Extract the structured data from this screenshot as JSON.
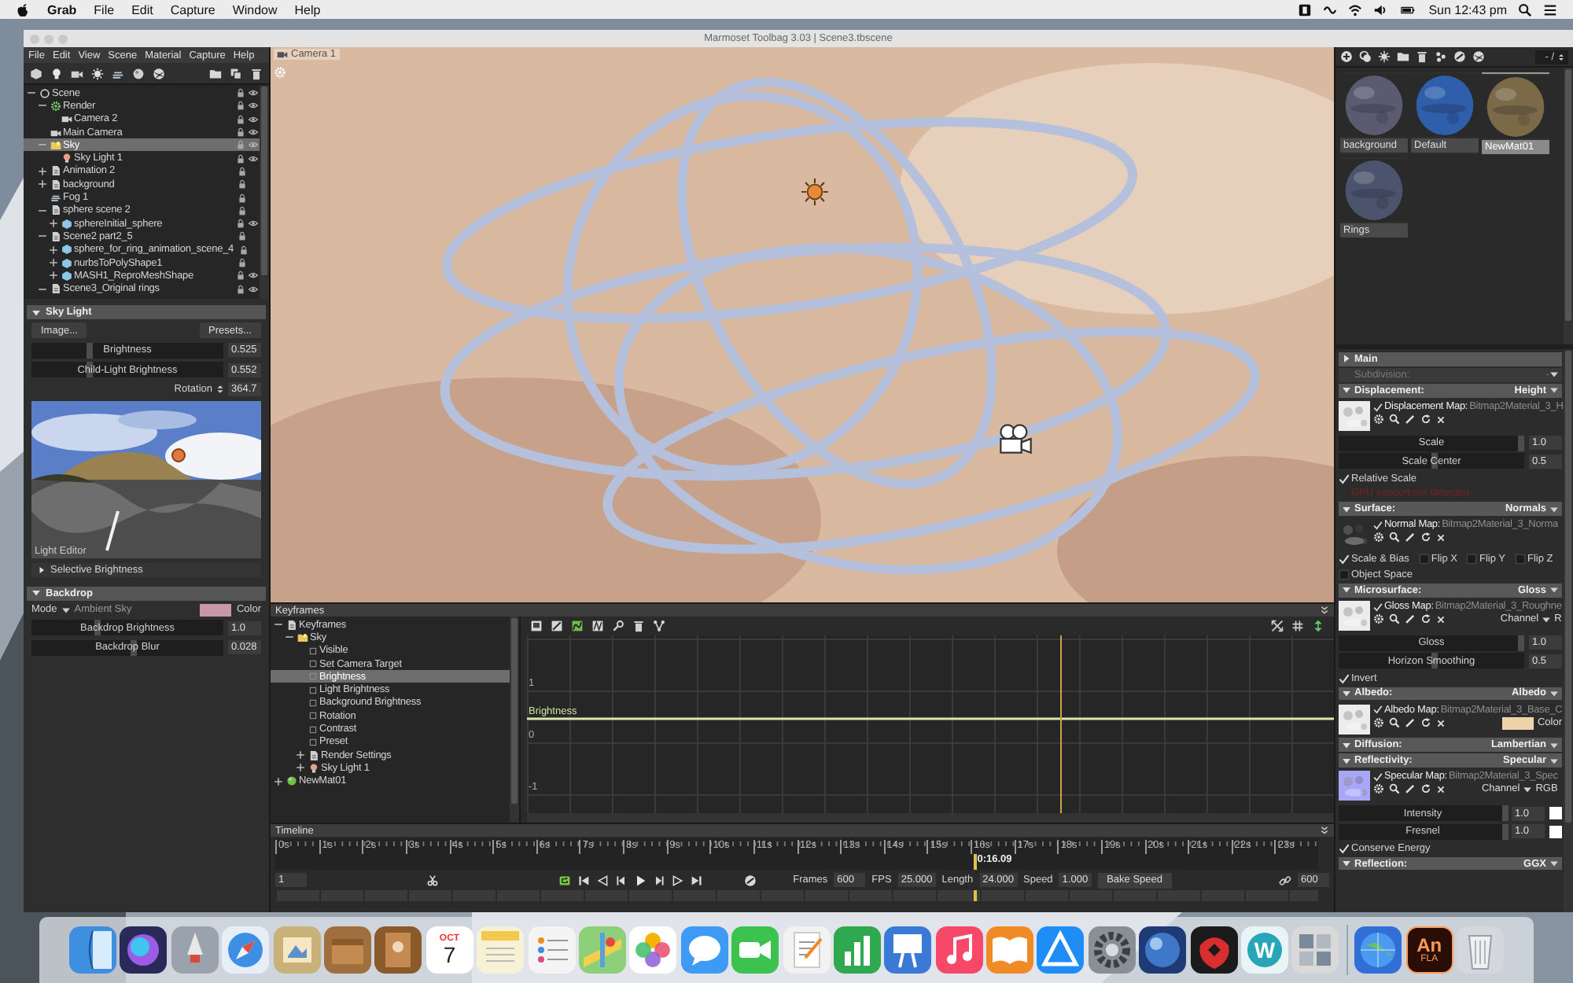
{
  "menubar": {
    "app": "Grab",
    "menus": [
      "File",
      "Edit",
      "Capture",
      "Window",
      "Help"
    ],
    "clock": "Sun 12:43 pm"
  },
  "window": {
    "title": "Marmoset Toolbag 3.03  |  Scene3.tbscene"
  },
  "app_menu": [
    "File",
    "Edit",
    "View",
    "Scene",
    "Material",
    "Capture",
    "Help"
  ],
  "scene_tree": [
    {
      "label": "Scene",
      "kind": "scene",
      "expanded": true,
      "selected": false,
      "visible": true,
      "children": [
        {
          "label": "Render",
          "kind": "render",
          "expanded": true,
          "selected": false,
          "visible": true,
          "children": [
            {
              "label": "Camera 2",
              "kind": "camera",
              "selected": false,
              "visible": true
            }
          ]
        },
        {
          "label": "Main Camera",
          "kind": "camera",
          "selected": false,
          "visible": true
        },
        {
          "label": "Sky",
          "kind": "sky",
          "expanded": true,
          "selected": true,
          "visible": true,
          "children": [
            {
              "label": "Sky Light 1",
              "kind": "light",
              "selected": false,
              "visible": true
            }
          ]
        },
        {
          "label": "Animation 2",
          "kind": "group",
          "expanded": false,
          "selected": false,
          "visible": false
        },
        {
          "label": "background",
          "kind": "group",
          "expanded": false,
          "selected": false,
          "visible": false
        },
        {
          "label": "Fog 1",
          "kind": "fog",
          "selected": false,
          "visible": false
        },
        {
          "label": "sphere scene 2",
          "kind": "group",
          "expanded": true,
          "selected": false,
          "visible": false,
          "children": [
            {
              "label": "sphereInitial_sphere",
              "kind": "mesh",
              "expanded": false,
              "selected": false,
              "visible": true
            }
          ]
        },
        {
          "label": "Scene2 part2_5",
          "kind": "group",
          "expanded": true,
          "selected": false,
          "visible": false,
          "children": [
            {
              "label": "sphere_for_ring_animation_scene_4",
              "kind": "mesh",
              "expanded": false,
              "selected": false,
              "visible": false
            },
            {
              "label": "nurbsToPolyShape1",
              "kind": "mesh",
              "expanded": false,
              "selected": false,
              "visible": false
            },
            {
              "label": "MASH1_ReproMeshShape",
              "kind": "mesh",
              "expanded": false,
              "selected": false,
              "visible": true
            }
          ]
        },
        {
          "label": "Scene3_Original rings",
          "kind": "group",
          "expanded": true,
          "selected": false,
          "visible": true
        }
      ]
    }
  ],
  "sky_light": {
    "title": "Sky Light",
    "expanded": true,
    "buttons": [
      "Image...",
      "Presets..."
    ],
    "sliders": [
      {
        "label": "Brightness",
        "value": "0.525",
        "level": 0.29
      },
      {
        "label": "Child-Light Brightness",
        "value": "0.552",
        "level": 0.29
      }
    ],
    "rotation": {
      "label": "Rotation",
      "value": "364.7"
    },
    "image_caption": "Light Editor",
    "selective": {
      "label": "Selective Brightness",
      "expanded": false
    }
  },
  "backdrop": {
    "title": "Backdrop",
    "expanded": true,
    "mode_label": "Mode",
    "mode_value": "Ambient Sky",
    "color": "#c897a8",
    "color_label": "Color",
    "sliders": [
      {
        "label": "Backdrop Brightness",
        "value": "1.0",
        "level": 0.33
      },
      {
        "label": "Backdrop Blur",
        "value": "0.028",
        "level": 0.52
      }
    ]
  },
  "viewport": {
    "tab": "Camera 1"
  },
  "keyframes": {
    "title": "Keyframes",
    "tree": [
      {
        "label": "Keyframes",
        "kind": "group",
        "expanded": true,
        "selected": false,
        "children": [
          {
            "label": "Sky",
            "kind": "sky",
            "expanded": true,
            "selected": false,
            "children": [
              {
                "label": "Visible",
                "kind": "channel",
                "selected": false
              },
              {
                "label": "Set Camera Target",
                "kind": "channel",
                "selected": false
              },
              {
                "label": "Brightness",
                "kind": "channel",
                "selected": true
              },
              {
                "label": "Light Brightness",
                "kind": "channel",
                "selected": false
              },
              {
                "label": "Background Brightness",
                "kind": "channel",
                "selected": false
              },
              {
                "label": "Rotation",
                "kind": "channel",
                "selected": false
              },
              {
                "label": "Contrast",
                "kind": "channel",
                "selected": false
              },
              {
                "label": "Preset",
                "kind": "channel",
                "selected": false
              },
              {
                "label": "Render Settings",
                "kind": "group",
                "expanded": false,
                "selected": false
              },
              {
                "label": "Sky Light 1",
                "kind": "light",
                "expanded": false,
                "selected": false
              }
            ]
          }
        ]
      },
      {
        "label": "NewMat01",
        "kind": "material",
        "expanded": false,
        "selected": false
      }
    ],
    "graph": {
      "yticks": [
        "1",
        "0",
        "-1"
      ],
      "curve_label": "Brightness",
      "level": 0.66
    }
  },
  "timeline": {
    "title": "Timeline",
    "ticks": [
      "0s",
      "1s",
      "2s",
      "3s",
      "4s",
      "5s",
      "6s",
      "7s",
      "8s",
      "9s",
      "10s",
      "11s",
      "12s",
      "13s",
      "14s",
      "15s",
      "16s",
      "17s",
      "18s",
      "19s",
      "20s",
      "21s",
      "22s",
      "23s"
    ],
    "playhead": "0:16.09",
    "level": 0.67,
    "start_frame": "1",
    "loop": true,
    "fields": [
      {
        "label": "Frames",
        "value": "600"
      },
      {
        "label": "FPS",
        "value": "25.000"
      },
      {
        "label": "Length",
        "value": "24.000"
      },
      {
        "label": "Speed",
        "value": "1.000"
      }
    ],
    "bake_button": "Bake Speed",
    "end_frame": "600"
  },
  "materials": {
    "counter": "- /",
    "items": [
      {
        "label": "background",
        "selected": false
      },
      {
        "label": "Default",
        "selected": false
      },
      {
        "label": "NewMat01",
        "selected": true
      },
      {
        "label": "Rings",
        "selected": false
      }
    ]
  },
  "properties": [
    {
      "kind": "section",
      "title": "Main",
      "expanded": false
    },
    {
      "kind": "dropdown",
      "label": "Subdivision:",
      "value": "-",
      "disabled": true
    },
    {
      "kind": "section",
      "title": "Displacement:",
      "value": "Height",
      "expanded": true
    },
    {
      "kind": "map",
      "label": "Displacement Map:",
      "file": "Bitmap2Material_3_H",
      "checked": true
    },
    {
      "kind": "slider",
      "label": "Scale",
      "value": "1.0",
      "level": 0.97
    },
    {
      "kind": "slider",
      "label": "Scale Center",
      "value": "0.5",
      "level": 0.5
    },
    {
      "kind": "check",
      "label": "Relative Scale",
      "checked": true
    },
    {
      "kind": "warning",
      "label": "GPU support not detected"
    },
    {
      "kind": "section",
      "title": "Surface:",
      "value": "Normals",
      "expanded": true
    },
    {
      "kind": "map",
      "label": "Normal Map:",
      "file": "Bitmap2Material_3_Norma",
      "checked": true
    },
    {
      "kind": "checks",
      "items": [
        {
          "label": "Scale & Bias",
          "checked": true
        },
        {
          "label": "Flip X",
          "checked": false
        },
        {
          "label": "Flip Y",
          "checked": false
        },
        {
          "label": "Flip Z",
          "checked": false
        }
      ]
    },
    {
      "kind": "check",
      "label": "Object Space",
      "checked": false
    },
    {
      "kind": "section",
      "title": "Microsurface:",
      "value": "Gloss",
      "expanded": true
    },
    {
      "kind": "map",
      "label": "Gloss Map:",
      "file": "Bitmap2Material_3_Roughne",
      "checked": true,
      "channel_label": "Channel",
      "channel": "R"
    },
    {
      "kind": "slider",
      "label": "Gloss",
      "value": "1.0",
      "level": 0.97
    },
    {
      "kind": "slider",
      "label": "Horizon Smoothing",
      "value": "0.5",
      "level": 0.5
    },
    {
      "kind": "check",
      "label": "Invert",
      "checked": true
    },
    {
      "kind": "section",
      "title": "Albedo:",
      "value": "Albedo",
      "expanded": true
    },
    {
      "kind": "map",
      "label": "Albedo Map:",
      "file": "Bitmap2Material_3_Base_C",
      "checked": true,
      "color": "#ecd3a9",
      "color_label": "Color"
    },
    {
      "kind": "section",
      "title": "Diffusion:",
      "value": "Lambertian",
      "expanded": true
    },
    {
      "kind": "section",
      "title": "Reflectivity:",
      "value": "Specular",
      "expanded": true
    },
    {
      "kind": "map",
      "label": "Specular Map:",
      "file": "Bitmap2Material_3_Spec",
      "checked": true,
      "channel_label": "Channel",
      "channel": "RGB"
    },
    {
      "kind": "slider",
      "label": "Intensity",
      "value": "1.0",
      "level": 0.97,
      "color": "#ffffff"
    },
    {
      "kind": "slider",
      "label": "Fresnel",
      "value": "1.0",
      "level": 0.97,
      "color": "#ffffff"
    },
    {
      "kind": "check",
      "label": "Conserve Energy",
      "checked": true
    },
    {
      "kind": "section",
      "title": "Reflection:",
      "value": "GGX",
      "expanded": true
    }
  ],
  "dock": {
    "calendar_month": "OCT",
    "calendar_day": "7",
    "letter_tile": "W",
    "animate_label": "An",
    "animate_caption": "FLA"
  }
}
